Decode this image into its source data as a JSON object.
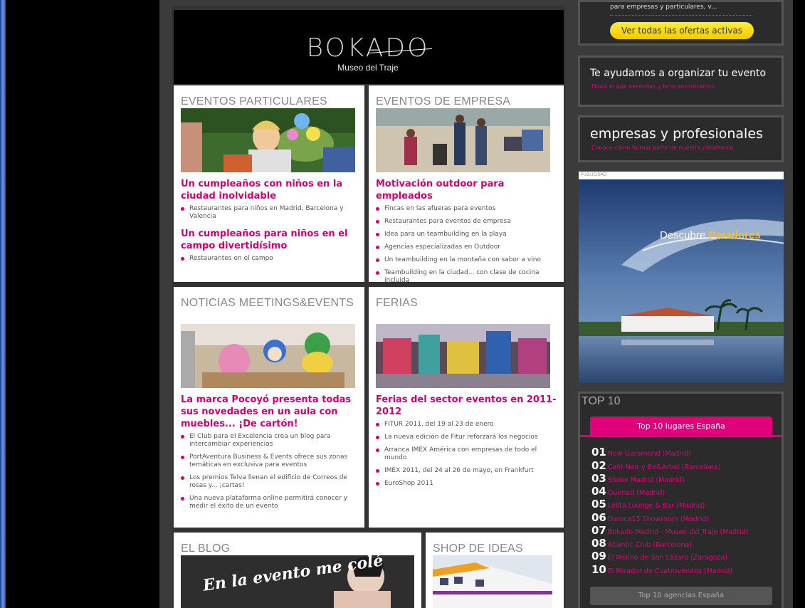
{
  "topbox": {
    "snippet": "para empresas y particulares, v...",
    "button": "Ver todas las ofertas activas"
  },
  "banner": {
    "logo": "BOKADO",
    "subtitle": "Museo del Traje"
  },
  "particulares": {
    "title": "EVENTOS PARTICULARES",
    "articles": [
      {
        "title": "Un cumpleaños con niños en la ciudad inolvidable",
        "bullets": [
          "Restaurantes para niños en Madrid, Barcelona y Valencia"
        ]
      },
      {
        "title": "Un cumpleaños para niños en el campo divertidísimo",
        "bullets": [
          "Restaurantes en el campo"
        ]
      }
    ]
  },
  "empresa": {
    "title": "EVENTOS DE EMPRESA",
    "article": "Motivación outdoor para empleados",
    "bullets": [
      "Fincas en las afueras para eventos",
      "Restaurantes para eventos de empresa",
      "Idea para un teambuilding en la playa",
      "Agencias especializadas en Outdoor",
      "Un teambuilding en la montaña con sabor a vino",
      "Teambuilding en la ciudad... con clase de cocina incluida"
    ]
  },
  "noticias": {
    "title": "NOTICIAS MEETINGS&EVENTS",
    "article": "La marca Pocoyó presenta todas sus novedades en un aula con muebles... ¡De cartón!",
    "bullets": [
      "El Club para el Excelencia crea un blog para intercambiar experiencias",
      "PortAventura Business & Events ofrece sus zonas temáticas en exclusiva para eventos",
      "Los premios Telva llenan el edificio de Correos de rosas y... ¡cartas!",
      "Una nueva plataforma online permitirá conocer y medir el éxito de un evento"
    ]
  },
  "ferias": {
    "title": "FERIAS",
    "article": "Ferias del sector eventos en 2011-2012",
    "bullets": [
      "FITUR 2011, del 19 al 23 de enero",
      "La nueva edición de Fitur reforzará los negocios",
      "Arranca IMEX América con empresas de todo el mundo",
      "IMEX 2011, del 24 al 26 de mayo, en Frankfurt",
      "EuroShop 2011"
    ]
  },
  "blog": {
    "title": "EL BLOG",
    "art_text": "En la evento me colé"
  },
  "shop": {
    "title": "SHOP DE IDEAS"
  },
  "organizar": {
    "title": "Te ayudamos a organizar tu evento",
    "sub": "Dinos lo que necesitas y te lo encontramos"
  },
  "empresas": {
    "title": "empresas y profesionales",
    "sub": "Conoce cómo formar parte de nuestra plataforma."
  },
  "ad": {
    "label": "PUBLICIDAD",
    "text1": "Descubre",
    "text2": "Paradores"
  },
  "top10": {
    "title": "TOP 10",
    "tab_active": "Top 10 lugares España",
    "tab_inactive": "Top 10 agencias España",
    "items": [
      {
        "n": "01",
        "label": "New Garamond (Madrid)"
      },
      {
        "n": "02",
        "label": "Café Noir y Be&Artist (Barcelona)"
      },
      {
        "n": "03",
        "label": "Shoko Madrid (Madrid)"
      },
      {
        "n": "04",
        "label": "Ouimad (Madrid)"
      },
      {
        "n": "05",
        "label": "Lolita Lounge & Bar (Madrid)"
      },
      {
        "n": "06",
        "label": "Daroca15 Showroom (Madrid)"
      },
      {
        "n": "07",
        "label": "Bokado Madrid - Museo del Traje (Madrid)"
      },
      {
        "n": "08",
        "label": "Atlantic Club (Barcelona)"
      },
      {
        "n": "09",
        "label": "El Molino de San Lázaro (Zaragoza)"
      },
      {
        "n": "10",
        "label": "El Mirador de Cuatrovientos (Madrid)"
      }
    ]
  },
  "colors": {
    "accent": "#d4006e",
    "yellow": "#f6c800",
    "background": "#000000"
  }
}
